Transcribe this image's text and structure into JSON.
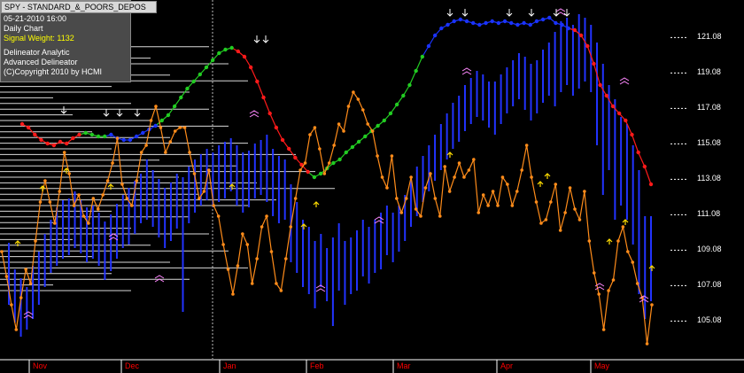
{
  "info": {
    "symbol": "SPY - STANDARD_&_POORS_DEPOS",
    "datetime": "05-21-2010  16:00",
    "period": "Daily Chart",
    "signal_weight": "Signal Weight: 1132",
    "line1": "Delineator Analytic",
    "line2": "Advanced Delineator",
    "copyright": "(C)Copyright 2010 by HCMI"
  },
  "colors": {
    "background": "#000000",
    "price_bars": "#2233ff",
    "oscillator": "#ff8c1a",
    "trend_green": "#22cc22",
    "trend_blue": "#1a33ff",
    "trend_red": "#ff1a1a",
    "month_labels": "#ff0000",
    "volume_profile": "#ffffff"
  },
  "chart_data": {
    "type": "line",
    "xlabel": "",
    "ylabel": "",
    "ylim": [
      103.2,
      123.2
    ],
    "y_ticks": [
      "121.08",
      "119.08",
      "117.08",
      "115.08",
      "113.08",
      "111.08",
      "109.08",
      "107.08",
      "105.08"
    ],
    "months": [
      "Nov",
      "Dec",
      "Jan",
      "Feb",
      "Mar",
      "Apr",
      "May"
    ],
    "price_bars": [
      {
        "lo": 106.0,
        "hi": 109.5
      },
      {
        "lo": 105.0,
        "hi": 108.0
      },
      {
        "lo": 104.2,
        "hi": 107.5
      },
      {
        "lo": 104.6,
        "hi": 107.0
      },
      {
        "lo": 105.2,
        "hi": 108.2
      },
      {
        "lo": 106.0,
        "hi": 109.0
      },
      {
        "lo": 107.0,
        "hi": 110.0
      },
      {
        "lo": 107.8,
        "hi": 110.8
      },
      {
        "lo": 108.2,
        "hi": 111.5
      },
      {
        "lo": 108.6,
        "hi": 111.9
      },
      {
        "lo": 108.8,
        "hi": 112.0
      },
      {
        "lo": 109.2,
        "hi": 112.4
      },
      {
        "lo": 108.9,
        "hi": 111.9
      },
      {
        "lo": 108.4,
        "hi": 111.5
      },
      {
        "lo": 108.6,
        "hi": 111.6
      },
      {
        "lo": 108.2,
        "hi": 111.2
      },
      {
        "lo": 107.4,
        "hi": 110.7
      },
      {
        "lo": 107.9,
        "hi": 111.1
      },
      {
        "lo": 108.6,
        "hi": 111.7
      },
      {
        "lo": 109.2,
        "hi": 112.2
      },
      {
        "lo": 109.4,
        "hi": 112.6
      },
      {
        "lo": 110.0,
        "hi": 113.0
      },
      {
        "lo": 110.6,
        "hi": 113.4
      },
      {
        "lo": 110.8,
        "hi": 114.2
      },
      {
        "lo": 110.4,
        "hi": 113.6
      },
      {
        "lo": 109.8,
        "hi": 113.1
      },
      {
        "lo": 109.2,
        "hi": 112.6
      },
      {
        "lo": 109.6,
        "hi": 112.9
      },
      {
        "lo": 110.3,
        "hi": 113.4
      },
      {
        "lo": 105.6,
        "hi": 113.2
      },
      {
        "lo": 110.6,
        "hi": 113.8
      },
      {
        "lo": 111.2,
        "hi": 114.2
      },
      {
        "lo": 111.6,
        "hi": 114.5
      },
      {
        "lo": 111.9,
        "hi": 114.8
      },
      {
        "lo": 111.5,
        "hi": 114.6
      },
      {
        "lo": 111.8,
        "hi": 115.0
      },
      {
        "lo": 112.0,
        "hi": 115.2
      },
      {
        "lo": 112.4,
        "hi": 115.4
      },
      {
        "lo": 111.6,
        "hi": 115.0
      },
      {
        "lo": 111.2,
        "hi": 114.6
      },
      {
        "lo": 111.5,
        "hi": 114.7
      },
      {
        "lo": 112.0,
        "hi": 115.1
      },
      {
        "lo": 112.2,
        "hi": 115.3
      },
      {
        "lo": 111.8,
        "hi": 115.6
      },
      {
        "lo": 111.0,
        "hi": 114.8
      },
      {
        "lo": 110.6,
        "hi": 114.4
      },
      {
        "lo": 110.8,
        "hi": 114.2
      },
      {
        "lo": 108.4,
        "hi": 112.8
      },
      {
        "lo": 107.8,
        "hi": 111.8
      },
      {
        "lo": 107.0,
        "hi": 110.8
      },
      {
        "lo": 106.6,
        "hi": 110.4
      },
      {
        "lo": 105.8,
        "hi": 109.6
      },
      {
        "lo": 107.0,
        "hi": 110.0
      },
      {
        "lo": 106.2,
        "hi": 109.2
      },
      {
        "lo": 104.8,
        "hi": 109.8
      },
      {
        "lo": 106.8,
        "hi": 110.6
      },
      {
        "lo": 106.0,
        "hi": 109.6
      },
      {
        "lo": 106.6,
        "hi": 109.8
      },
      {
        "lo": 106.8,
        "hi": 110.2
      },
      {
        "lo": 107.6,
        "hi": 110.8
      },
      {
        "lo": 107.2,
        "hi": 110.4
      },
      {
        "lo": 107.8,
        "hi": 110.8
      },
      {
        "lo": 108.0,
        "hi": 111.2
      },
      {
        "lo": 108.8,
        "hi": 111.6
      },
      {
        "lo": 108.4,
        "hi": 111.2
      },
      {
        "lo": 109.0,
        "hi": 111.6
      },
      {
        "lo": 109.6,
        "hi": 112.2
      },
      {
        "lo": 110.4,
        "hi": 113.0
      },
      {
        "lo": 111.0,
        "hi": 113.8
      },
      {
        "lo": 111.8,
        "hi": 114.4
      },
      {
        "lo": 112.4,
        "hi": 115.0
      },
      {
        "lo": 113.0,
        "hi": 115.6
      },
      {
        "lo": 113.6,
        "hi": 116.2
      },
      {
        "lo": 114.2,
        "hi": 116.8
      },
      {
        "lo": 114.8,
        "hi": 117.4
      },
      {
        "lo": 115.2,
        "hi": 117.8
      },
      {
        "lo": 115.8,
        "hi": 118.4
      },
      {
        "lo": 116.2,
        "hi": 118.8
      },
      {
        "lo": 116.6,
        "hi": 119.2
      },
      {
        "lo": 116.4,
        "hi": 119.0
      },
      {
        "lo": 116.0,
        "hi": 118.6
      },
      {
        "lo": 115.6,
        "hi": 118.6
      },
      {
        "lo": 116.2,
        "hi": 119.0
      },
      {
        "lo": 116.8,
        "hi": 119.4
      },
      {
        "lo": 117.2,
        "hi": 119.8
      },
      {
        "lo": 117.6,
        "hi": 120.2
      },
      {
        "lo": 117.0,
        "hi": 120.0
      },
      {
        "lo": 116.4,
        "hi": 119.6
      },
      {
        "lo": 116.8,
        "hi": 119.8
      },
      {
        "lo": 117.4,
        "hi": 120.4
      },
      {
        "lo": 117.8,
        "hi": 120.8
      },
      {
        "lo": 117.2,
        "hi": 121.4
      },
      {
        "lo": 118.0,
        "hi": 122.0
      },
      {
        "lo": 118.4,
        "hi": 122.2
      },
      {
        "lo": 117.8,
        "hi": 121.8
      },
      {
        "lo": 118.2,
        "hi": 122.4
      },
      {
        "lo": 118.6,
        "hi": 122.2
      },
      {
        "lo": 118.0,
        "hi": 121.8
      },
      {
        "lo": 115.0,
        "hi": 120.8
      },
      {
        "lo": 112.2,
        "hi": 119.6
      },
      {
        "lo": 113.6,
        "hi": 118.4
      },
      {
        "lo": 110.8,
        "hi": 117.6
      },
      {
        "lo": 111.6,
        "hi": 116.6
      },
      {
        "lo": 110.8,
        "hi": 116.2
      },
      {
        "lo": 109.4,
        "hi": 115.0
      },
      {
        "lo": 106.6,
        "hi": 113.6
      },
      {
        "lo": 105.2,
        "hi": 111.0
      },
      {
        "lo": 106.2,
        "hi": 111.0
      }
    ],
    "oscillator": [
      109.0,
      107.6,
      106.0,
      104.6,
      106.4,
      108.0,
      107.2,
      109.6,
      111.8,
      113.0,
      111.8,
      110.6,
      112.4,
      114.6,
      113.4,
      111.6,
      112.2,
      111.0,
      110.6,
      112.0,
      111.4,
      112.2,
      113.0,
      114.0,
      115.4,
      112.8,
      112.0,
      111.6,
      113.0,
      114.6,
      115.0,
      116.4,
      117.2,
      116.0,
      114.6,
      115.2,
      115.8,
      116.0,
      116.0,
      114.6,
      113.4,
      112.0,
      112.4,
      113.6,
      111.6,
      111.0,
      109.4,
      108.0,
      106.6,
      108.2,
      110.0,
      109.4,
      107.2,
      108.6,
      110.4,
      111.0,
      109.0,
      107.2,
      106.8,
      108.6,
      110.4,
      112.0,
      113.6,
      114.0,
      115.6,
      116.0,
      114.8,
      113.4,
      114.0,
      115.0,
      116.2,
      115.8,
      117.2,
      118.0,
      117.6,
      117.0,
      116.2,
      115.8,
      114.4,
      113.2,
      112.6,
      114.4,
      112.0,
      111.2,
      112.0,
      113.2,
      111.4,
      111.0,
      112.6,
      113.4,
      112.0,
      111.0,
      113.8,
      112.4,
      113.2,
      114.0,
      113.2,
      113.6,
      114.2,
      111.2,
      112.2,
      111.6,
      112.4,
      111.6,
      113.2,
      112.8,
      111.6,
      112.4,
      113.6,
      115.0,
      113.2,
      111.8,
      110.6,
      110.8,
      111.8,
      112.8,
      110.2,
      111.2,
      112.6,
      111.4,
      110.8,
      112.4,
      109.6,
      107.8,
      106.6,
      104.6,
      106.8,
      107.4,
      109.6,
      110.4,
      109.0,
      108.4,
      107.2,
      106.4,
      103.8,
      106.0
    ],
    "trend_line": [
      116.2,
      116.0,
      115.6,
      115.3,
      115.1,
      115.0,
      115.2,
      115.1,
      115.4,
      115.6,
      115.7,
      115.6,
      115.5,
      115.5,
      115.6,
      115.4,
      115.3,
      115.3,
      115.5,
      115.7,
      115.9,
      116.1,
      116.4,
      116.7,
      117.2,
      117.7,
      118.2,
      118.6,
      119.0,
      119.4,
      119.8,
      120.2,
      120.4,
      120.5,
      120.3,
      120.0,
      119.4,
      118.6,
      117.7,
      116.8,
      116.0,
      115.3,
      114.8,
      114.3,
      113.9,
      113.5,
      113.2,
      113.4,
      113.7,
      114.0,
      114.2,
      114.6,
      114.9,
      115.2,
      115.5,
      115.8,
      116.1,
      116.4,
      116.8,
      117.3,
      117.8,
      118.4,
      119.2,
      120.0,
      120.6,
      121.2,
      121.6,
      121.8,
      122.0,
      122.1,
      122.0,
      121.9,
      121.8,
      121.9,
      122.0,
      121.9,
      122.0,
      121.9,
      121.8,
      121.9,
      121.8,
      122.0,
      122.1,
      122.2,
      121.9,
      121.8,
      121.6,
      121.5,
      121.2,
      120.6,
      119.6,
      118.4,
      117.8,
      117.2,
      116.8,
      116.4,
      115.6,
      114.6,
      113.8,
      112.8
    ],
    "trend_colors": {
      "red_until": 10,
      "green_from": 10,
      "blue_from": 14,
      "green2_from": 22,
      "red_from": 34,
      "green3_from": 46,
      "blue2_from": 64,
      "red2_from": 87
    }
  },
  "labels": {
    "months": [
      "Nov",
      "Dec",
      "Jan",
      "Feb",
      "Mar",
      "Apr",
      "May"
    ]
  }
}
